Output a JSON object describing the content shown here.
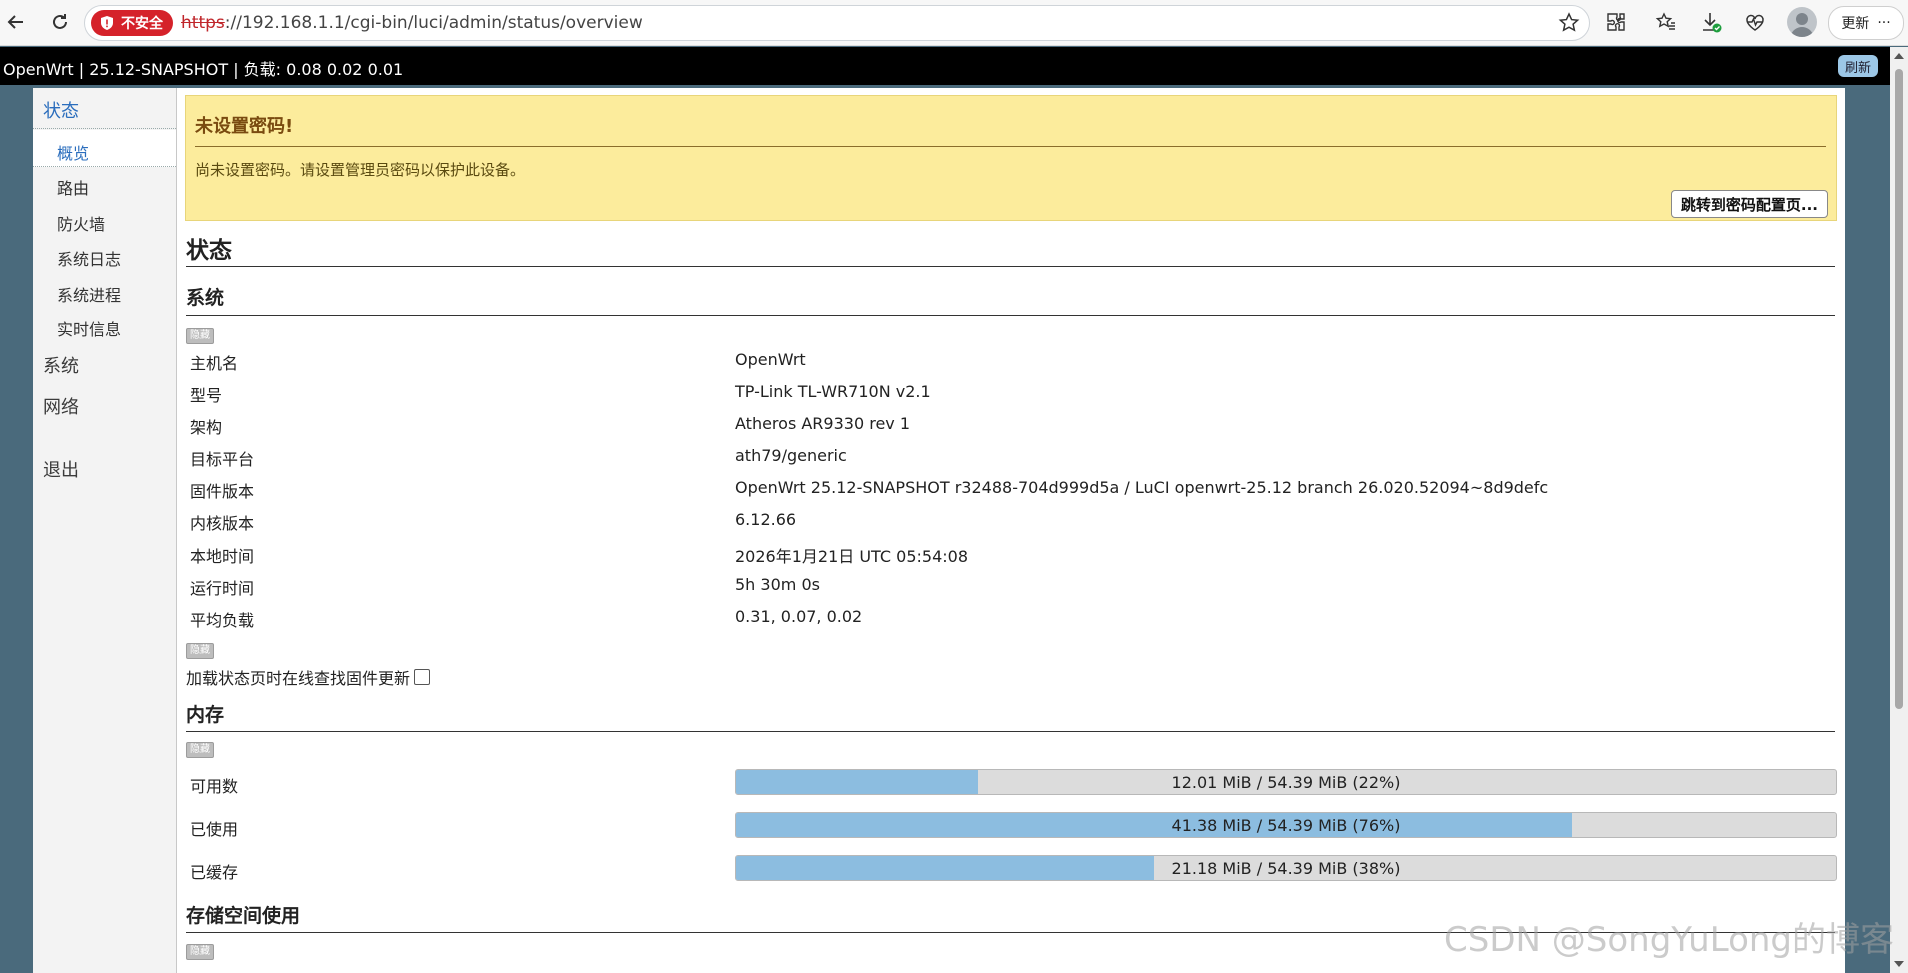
{
  "browser": {
    "security_label": "不安全",
    "url_scheme": "https",
    "url_rest": "://192.168.1.1/cgi-bin/luci/admin/status/overview",
    "update_label": "更新",
    "more_label": "···"
  },
  "header": {
    "brand": "OpenWrt | 25.12-SNAPSHOT | 负载: 0.08 0.02 0.01",
    "refresh_label": "刷新"
  },
  "sidebar": {
    "categories": [
      {
        "label": "状态",
        "active": true
      },
      {
        "label": "系统"
      },
      {
        "label": "网络"
      },
      {
        "label": "退出"
      }
    ],
    "status_items": [
      {
        "label": "概览",
        "active": true
      },
      {
        "label": "路由"
      },
      {
        "label": "防火墙"
      },
      {
        "label": "系统日志"
      },
      {
        "label": "系统进程"
      },
      {
        "label": "实时信息"
      }
    ]
  },
  "alert": {
    "title": "未设置密码!",
    "text": "尚未设置密码。请设置管理员密码以保护此设备。",
    "button": "跳转到密码配置页..."
  },
  "page": {
    "title": "状态",
    "hide_label": "隐藏"
  },
  "system": {
    "title": "系统",
    "rows": [
      {
        "label": "主机名",
        "value": "OpenWrt"
      },
      {
        "label": "型号",
        "value": "TP-Link TL-WR710N v2.1"
      },
      {
        "label": "架构",
        "value": "Atheros AR9330 rev 1"
      },
      {
        "label": "目标平台",
        "value": "ath79/generic"
      },
      {
        "label": "固件版本",
        "value": "OpenWrt 25.12-SNAPSHOT r32488-704d999d5a / LuCI openwrt-25.12 branch 26.020.52094~8d9defc"
      },
      {
        "label": "内核版本",
        "value": "6.12.66"
      },
      {
        "label": "本地时间",
        "value": "2026年1月21日 UTC 05:54:08"
      },
      {
        "label": "运行时间",
        "value": "5h 30m 0s"
      },
      {
        "label": "平均负载",
        "value": "0.31, 0.07, 0.02"
      }
    ],
    "check_updates_label": "加载状态页时在线查找固件更新"
  },
  "memory": {
    "title": "内存",
    "rows": [
      {
        "label": "可用数",
        "text": "12.01 MiB / 54.39 MiB (22%)",
        "percent": 22
      },
      {
        "label": "已使用",
        "text": "41.38 MiB / 54.39 MiB (76%)",
        "percent": 76
      },
      {
        "label": "已缓存",
        "text": "21.18 MiB / 54.39 MiB (38%)",
        "percent": 38
      }
    ]
  },
  "storage": {
    "title": "存储空间使用"
  },
  "watermark": "CSDN @SongYuLong的博客",
  "colors": {
    "header_bg": "#000000",
    "alert_bg": "#fcec9c",
    "bar_fill": "#8cbde0",
    "bar_bg": "#dcdcdc",
    "active_link": "#2a6dbd",
    "security_red": "#d5222a"
  }
}
